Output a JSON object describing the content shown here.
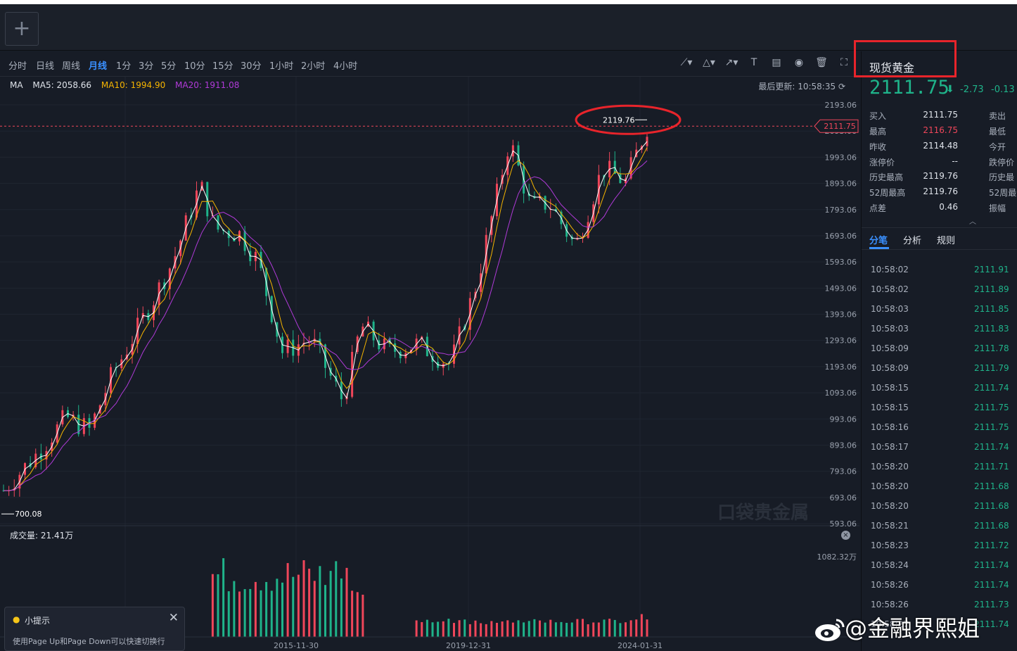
{
  "topbar": {
    "add_label": "+"
  },
  "periods": [
    "分时",
    "日线",
    "周线",
    "月线",
    "1分",
    "3分",
    "5分",
    "10分",
    "15分",
    "30分",
    "1小时",
    "2小时",
    "4小时"
  ],
  "active_period": "月线",
  "indicator": {
    "name": "MA",
    "ma5": "MA5: 2058.66",
    "ma10": "MA10: 1994.90",
    "ma20": "MA20: 1911.08",
    "colors": {
      "price_up": "#f0465a",
      "price_down": "#1fb38a",
      "ma5": "#ffffff",
      "ma10": "#f5b400",
      "ma20": "#b03ad8"
    }
  },
  "last_update": "最后更新: 10:58:35",
  "chart_data": {
    "type": "candlestick",
    "title": "",
    "y_ticks": [
      2193.06,
      2093.06,
      1993.06,
      1893.06,
      1793.06,
      1693.06,
      1593.06,
      1493.06,
      1393.06,
      1293.06,
      1193.06,
      1093.06,
      993.06,
      893.06,
      793.06,
      693.06,
      593.06
    ],
    "ylim": [
      593.06,
      2193.06
    ],
    "x_ticks": [
      "2015-11-30",
      "2019-12-31",
      "2024-01-31"
    ],
    "current_price_label": "2111.75",
    "max_label": "2119.76",
    "min_label": "700.08",
    "watermark": "口袋贵金属",
    "approx_close_path": [
      {
        "x": "2005",
        "y": 720
      },
      {
        "x": "2006",
        "y": 870
      },
      {
        "x": "2007",
        "y": 1000
      },
      {
        "x": "2008",
        "y": 1150
      },
      {
        "x": "2009",
        "y": 1400
      },
      {
        "x": "2010",
        "y": 1600
      },
      {
        "x": "2011-08",
        "y": 1900
      },
      {
        "x": "2012",
        "y": 1700
      },
      {
        "x": "2013",
        "y": 1600
      },
      {
        "x": "2014",
        "y": 1250
      },
      {
        "x": "2015-11-30",
        "y": 1060
      },
      {
        "x": "2016",
        "y": 1350
      },
      {
        "x": "2017",
        "y": 1250
      },
      {
        "x": "2018",
        "y": 1280
      },
      {
        "x": "2019-12-31",
        "y": 1520
      },
      {
        "x": "2020-08",
        "y": 2060
      },
      {
        "x": "2021",
        "y": 1800
      },
      {
        "x": "2022",
        "y": 1650
      },
      {
        "x": "2023",
        "y": 1950
      },
      {
        "x": "2024-01-31",
        "y": 2111
      }
    ],
    "volume": {
      "label": "成交量: 21.41万",
      "max_label": "1082.32万"
    }
  },
  "tip": {
    "title": "小提示",
    "text": "使用Page Up和Page Down可以快速切换行"
  },
  "instrument": {
    "name": "现货黄金",
    "price": "2111.75",
    "change": "-2.73",
    "change_pct": "-0.13"
  },
  "quote": [
    {
      "label": "买入",
      "value": "2111.75",
      "label2": "卖出"
    },
    {
      "label": "最高",
      "value": "2116.75",
      "label2": "最低",
      "red": true
    },
    {
      "label": "昨收",
      "value": "2114.48",
      "label2": "今开"
    },
    {
      "label": "涨停价",
      "value": "--",
      "label2": "跌停价"
    },
    {
      "label": "历史最高",
      "value": "2119.76",
      "label2": "历史最"
    },
    {
      "label": "52周最高",
      "value": "2119.76",
      "label2": "52周最"
    },
    {
      "label": "点差",
      "value": "0.46",
      "label2": "振幅"
    }
  ],
  "sub_tabs": [
    "分笔",
    "分析",
    "规则"
  ],
  "ticks": [
    {
      "time": "10:58:02",
      "price": "2111.91"
    },
    {
      "time": "10:58:02",
      "price": "2111.89"
    },
    {
      "time": "10:58:03",
      "price": "2111.85"
    },
    {
      "time": "10:58:03",
      "price": "2111.83"
    },
    {
      "time": "10:58:09",
      "price": "2111.78"
    },
    {
      "time": "10:58:09",
      "price": "2111.79"
    },
    {
      "time": "10:58:15",
      "price": "2111.74"
    },
    {
      "time": "10:58:15",
      "price": "2111.75"
    },
    {
      "time": "10:58:16",
      "price": "2111.75"
    },
    {
      "time": "10:58:17",
      "price": "2111.74"
    },
    {
      "time": "10:58:20",
      "price": "2111.71"
    },
    {
      "time": "10:58:20",
      "price": "2111.68"
    },
    {
      "time": "10:58:20",
      "price": "2111.68"
    },
    {
      "time": "10:58:21",
      "price": "2111.68"
    },
    {
      "time": "10:58:23",
      "price": "2111.72"
    },
    {
      "time": "10:58:24",
      "price": "2111.74"
    },
    {
      "time": "10:58:26",
      "price": "2111.74"
    },
    {
      "time": "10:58:26",
      "price": "2111.73"
    },
    {
      "time": "10:58:27",
      "price": "2111.74"
    }
  ],
  "watermark_text": "@金融界熙姐"
}
